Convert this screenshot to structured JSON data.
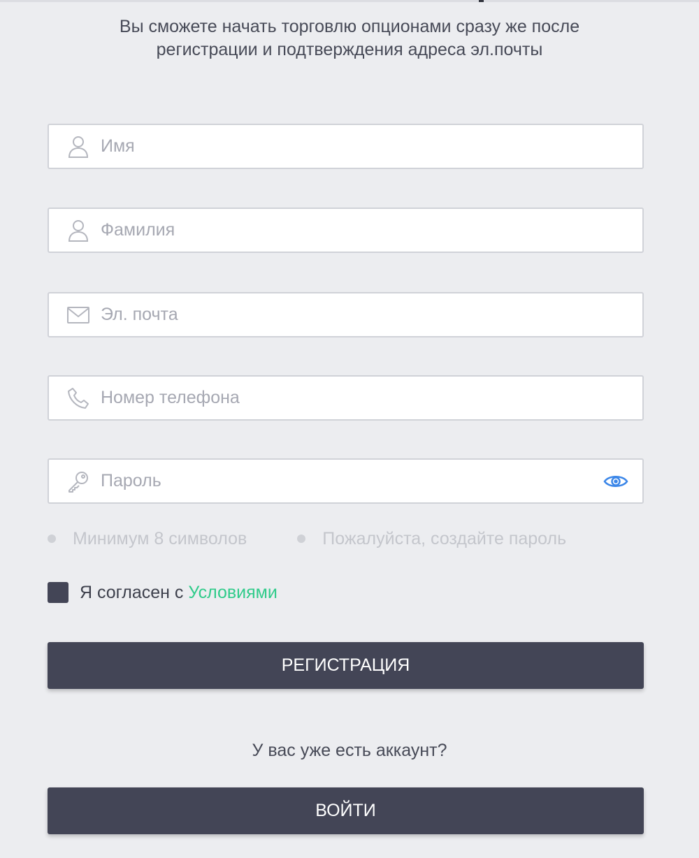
{
  "intro": {
    "line1": "Вы сможете начать торговлю опционами сразу же после",
    "line2": "регистрации и подтверждения адреса эл.почты"
  },
  "form": {
    "first_name": {
      "placeholder": "Имя",
      "value": "",
      "icon": "user-icon"
    },
    "last_name": {
      "placeholder": "Фамилия",
      "value": "",
      "icon": "user-icon"
    },
    "email": {
      "placeholder": "Эл. почта",
      "value": "",
      "icon": "envelope-icon"
    },
    "phone": {
      "placeholder": "Номер телефона",
      "value": "",
      "icon": "phone-icon"
    },
    "password": {
      "placeholder": "Пароль",
      "value": "",
      "icon": "key-icon",
      "toggle_icon": "eye-icon"
    }
  },
  "password_hints": [
    "Минимум 8 символов",
    "Пожалуйста, создайте пароль"
  ],
  "agreement": {
    "text": "Я согласен с",
    "link": "Условиями"
  },
  "register_button": "РЕГИСТРАЦИЯ",
  "have_account_text": "У вас уже есть аккаунт?",
  "login_button": "ВОЙТИ",
  "colors": {
    "background": "#ecedf0",
    "button": "#434556",
    "link": "#2fcb8a",
    "eye_icon": "#3b86e8",
    "placeholder": "#a6a8b2"
  }
}
